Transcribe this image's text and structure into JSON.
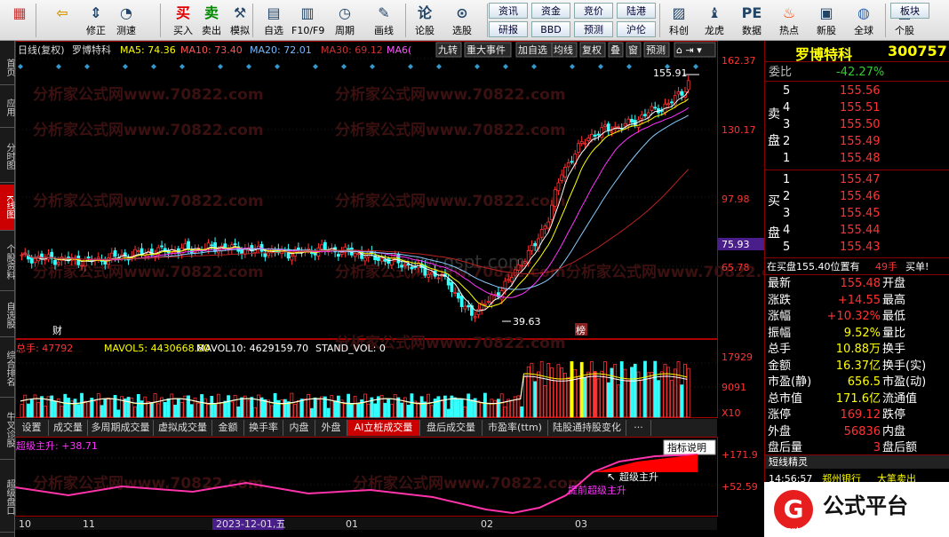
{
  "toolbar": {
    "items": [
      {
        "label": "",
        "icon": "grid-icon"
      },
      {
        "label": "",
        "icon": "back-arrow-icon"
      },
      {
        "label": "修正",
        "icon": "up-down-arrows-icon"
      },
      {
        "label": "测速",
        "icon": "speedometer-icon"
      },
      {
        "label": "买入",
        "icon": "buy-icon"
      },
      {
        "label": "卖出",
        "icon": "sell-icon"
      },
      {
        "label": "模拟",
        "icon": "hammer-icon"
      },
      {
        "label": "自选",
        "icon": "folder-icon"
      },
      {
        "label": "F10/F9",
        "icon": "f10-icon"
      },
      {
        "label": "周期",
        "icon": "clock-icon"
      },
      {
        "label": "画线",
        "icon": "pencil-icon"
      },
      {
        "label": "论股",
        "icon": "discuss-icon"
      },
      {
        "label": "选股",
        "icon": "magnifier-chart-icon"
      },
      {
        "label": "科创",
        "icon": "star-chart-icon"
      },
      {
        "label": "龙虎",
        "icon": "dragon-icon"
      },
      {
        "label": "数据",
        "icon": "pe-icon"
      },
      {
        "label": "热点",
        "icon": "fire-icon"
      },
      {
        "label": "新股",
        "icon": "new-stock-icon"
      },
      {
        "label": "全球",
        "icon": "globe-icon"
      },
      {
        "label": "个股",
        "icon": "stock-icon"
      }
    ],
    "small_buttons": [
      "资讯",
      "资金",
      "竞价",
      "陆港",
      "研报",
      "BBD",
      "预测",
      "沪伦",
      "板块"
    ]
  },
  "leftbar": [
    "首页",
    "应用",
    "分时图",
    "K线图",
    "个股资料",
    "自选股",
    "综合排名",
    "牛叉诊股",
    "超级盘口"
  ],
  "chart": {
    "ma_line": {
      "period": "日线(复权)",
      "name": "罗博特科",
      "ma5": "MA5: 74.36",
      "ma10": "MA10: 73.40",
      "ma20": "MA20: 72.01",
      "ma30": "MA30: 69.12",
      "ma60": "MA6("
    },
    "top_buttons": [
      "九转",
      "重大事件",
      "加自选",
      "均线",
      "复权",
      "叠",
      "窗",
      "预测"
    ],
    "price_axis": [
      "162.37",
      "130.17",
      "97.98",
      "75.93",
      "65.78"
    ],
    "high_label": "155.91",
    "low_label": "39.63",
    "cai_tag": "财",
    "bang_tag": "榜",
    "watermark": "分析家公式网www.70822.com",
    "watermark2": "www.gspt.com",
    "vol_line": {
      "total": "总手: 47792",
      "mavol5": "MAVOL5: 4430668.80",
      "mavol10": "MAVOL10: 4629159.70",
      "stand": "STAND_VOL: 0"
    },
    "vol_axis": [
      "17929",
      "9091",
      "X10"
    ],
    "tabs": [
      "设置",
      "成交量",
      "多周期成交量",
      "虚拟成交量",
      "金额",
      "换手率",
      "内盘",
      "外盘",
      "AI立桩成交量",
      "盘后成交量",
      "市盈率(ttm)",
      "陆股通持股变化",
      "···"
    ],
    "active_tab": "AI立桩成交量",
    "ind_line": "超级主升: +38.71",
    "ind_button": "指标说明",
    "ind_axis": [
      "+171.9",
      "+52.59"
    ],
    "ind_label1": "超级主升",
    "ind_label2": "提前超级主升",
    "date_axis": [
      "10",
      "11",
      "2023-12-01,五",
      "01",
      "02",
      "03"
    ]
  },
  "quote": {
    "name": "罗博特科",
    "code": "300757",
    "weibi_label": "委比",
    "weibi": "-42.27%",
    "sell_label": [
      "卖",
      "盘"
    ],
    "buy_label": [
      "买",
      "盘"
    ],
    "asks": [
      {
        "lvl": "5",
        "price": "155.56",
        "vol": ""
      },
      {
        "lvl": "4",
        "price": "155.51",
        "vol": ""
      },
      {
        "lvl": "3",
        "price": "155.50",
        "vol": ""
      },
      {
        "lvl": "2",
        "price": "155.49",
        "vol": ""
      },
      {
        "lvl": "1",
        "price": "155.48",
        "vol": ""
      }
    ],
    "bids": [
      {
        "lvl": "1",
        "price": "155.47",
        "vol": ""
      },
      {
        "lvl": "2",
        "price": "155.46",
        "vol": ""
      },
      {
        "lvl": "3",
        "price": "155.45",
        "vol": ""
      },
      {
        "lvl": "4",
        "price": "155.44",
        "vol": ""
      },
      {
        "lvl": "5",
        "price": "155.43",
        "vol": ""
      }
    ],
    "buy_note": "在买盘155.40位置有",
    "buy_note_vol": "49手",
    "buy_note_tail": "买单!",
    "stats": [
      {
        "l1": "最新",
        "v1": "155.48",
        "l2": "开盘",
        "v2": ""
      },
      {
        "l1": "涨跌",
        "v1": "+14.55",
        "l2": "最高",
        "v2": ""
      },
      {
        "l1": "涨幅",
        "v1": "+10.32%",
        "l2": "最低",
        "v2": ""
      },
      {
        "l1": "振幅",
        "v1": "9.52%",
        "l2": "量比",
        "v2": ""
      },
      {
        "l1": "总手",
        "v1": "10.88万",
        "l2": "换手",
        "v2": ""
      },
      {
        "l1": "金额",
        "v1": "16.37亿",
        "l2": "换手(实)",
        "v2": ""
      },
      {
        "l1": "市盈(静)",
        "v1": "656.5",
        "l2": "市盈(动)",
        "v2": ""
      },
      {
        "l1": "总市值",
        "v1": "171.6亿",
        "l2": "流通值",
        "v2": ""
      },
      {
        "l1": "涨停",
        "v1": "169.12",
        "l2": "跌停",
        "v2": ""
      },
      {
        "l1": "外盘",
        "v1": "56836",
        "l2": "内盘",
        "v2": ""
      },
      {
        "l1": "盘后量",
        "v1": "3",
        "l2": "盘后额",
        "v2": ""
      }
    ],
    "sprite_title": "短线精灵",
    "sprite_row": {
      "time": "14:56:57",
      "stock": "郑州银行",
      "event": "大笔卖出"
    },
    "logo_text": "公式平台",
    "logo_sub": "gspt"
  }
}
